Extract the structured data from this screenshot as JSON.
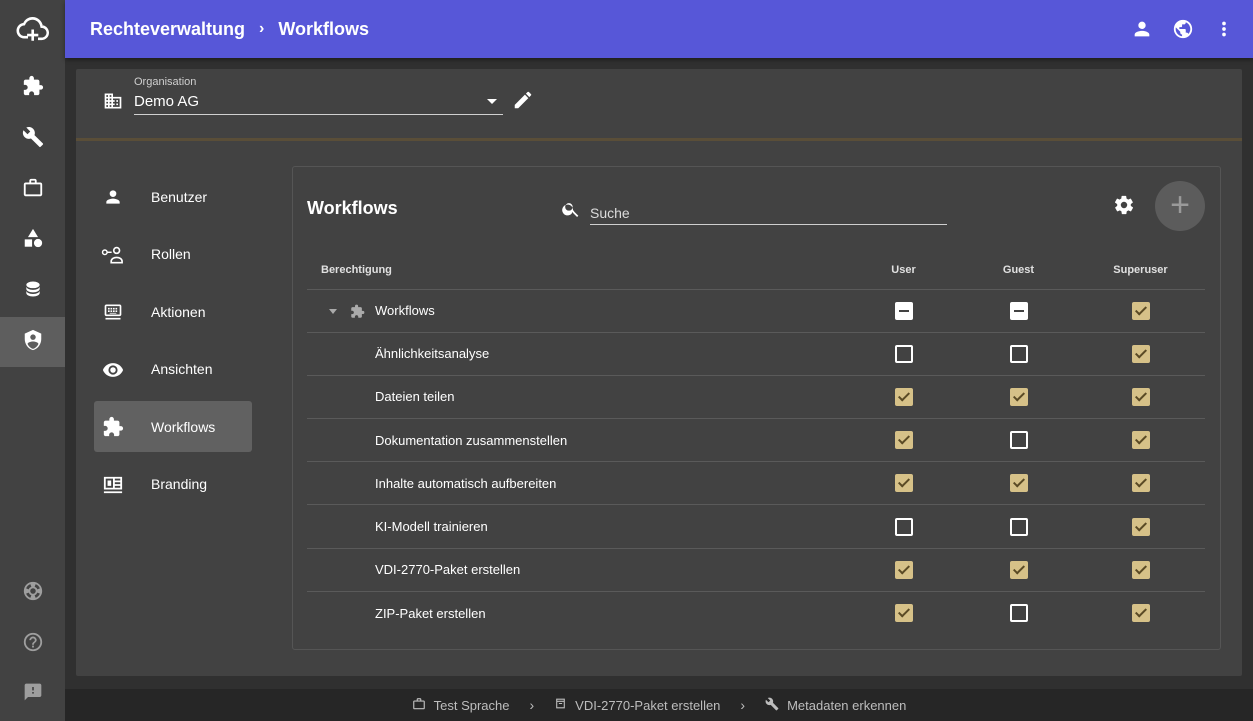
{
  "colors": {
    "primary": "#5757d8",
    "accent": "#d6c188",
    "background": "#303030",
    "surface": "#424242"
  },
  "rail": {
    "logo": "cloud-plus-icon",
    "items": [
      {
        "icon": "puzzle-icon",
        "active": false
      },
      {
        "icon": "wrench-icon",
        "active": false
      },
      {
        "icon": "briefcase-icon",
        "active": false
      },
      {
        "icon": "shapes-icon",
        "active": false
      },
      {
        "icon": "database-icon",
        "active": false
      },
      {
        "icon": "shield-account-icon",
        "active": true
      }
    ],
    "bottom": [
      "lifebuoy-icon",
      "help-icon",
      "feedback-icon"
    ]
  },
  "header": {
    "breadcrumb": [
      "Rechteverwaltung",
      "Workflows"
    ],
    "separator": "›",
    "actions": [
      "account-icon",
      "globe-icon",
      "more-vert-icon"
    ]
  },
  "org": {
    "label": "Organisation",
    "value": "Demo AG"
  },
  "nav": {
    "items": [
      {
        "label": "Benutzer",
        "icon": "person-icon",
        "selected": false
      },
      {
        "label": "Rollen",
        "icon": "roles-icon",
        "selected": false
      },
      {
        "label": "Aktionen",
        "icon": "keyboard-icon",
        "selected": false
      },
      {
        "label": "Ansichten",
        "icon": "eye-icon",
        "selected": false
      },
      {
        "label": "Workflows",
        "icon": "puzzle-icon",
        "selected": true
      },
      {
        "label": "Branding",
        "icon": "branding-icon",
        "selected": false
      }
    ]
  },
  "panel": {
    "title": "Workflows",
    "search_placeholder": "Suche",
    "add_symbol": "+",
    "columns": [
      "Berechtigung",
      "User",
      "Guest",
      "Superuser"
    ],
    "rows": [
      {
        "name": "Workflows",
        "group": true,
        "user": "indeterminate",
        "guest": "indeterminate",
        "superuser": "checked"
      },
      {
        "name": "Ähnlichkeitsanalyse",
        "user": "unchecked",
        "guest": "unchecked",
        "superuser": "checked"
      },
      {
        "name": "Dateien teilen",
        "user": "checked",
        "guest": "checked",
        "superuser": "checked"
      },
      {
        "name": "Dokumentation zusammenstellen",
        "user": "checked",
        "guest": "unchecked",
        "superuser": "checked"
      },
      {
        "name": "Inhalte automatisch aufbereiten",
        "user": "checked",
        "guest": "checked",
        "superuser": "checked"
      },
      {
        "name": "KI-Modell trainieren",
        "user": "unchecked",
        "guest": "unchecked",
        "superuser": "checked"
      },
      {
        "name": "VDI-2770-Paket erstellen",
        "user": "checked",
        "guest": "checked",
        "superuser": "checked"
      },
      {
        "name": "ZIP-Paket erstellen",
        "user": "checked",
        "guest": "unchecked",
        "superuser": "checked"
      }
    ]
  },
  "status_bar": {
    "items": [
      {
        "label": "Test Sprache",
        "icon": "briefcase-icon"
      },
      {
        "label": "VDI-2770-Paket erstellen",
        "icon": "package-icon"
      },
      {
        "label": "Metadaten erkennen",
        "icon": "wrench-icon"
      }
    ],
    "separator": "›"
  }
}
